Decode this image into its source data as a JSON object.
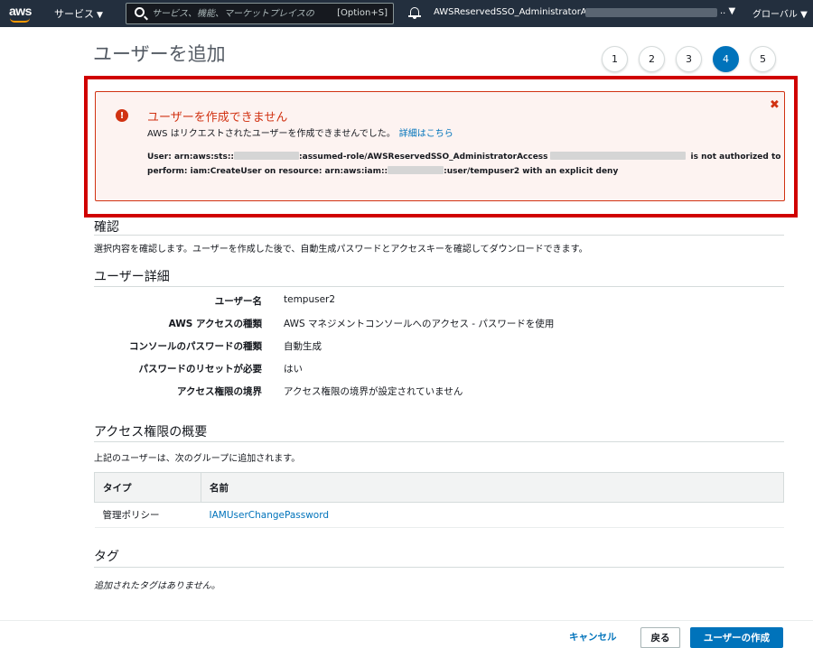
{
  "nav": {
    "logo_text": "aws",
    "services_label": "サービス",
    "services_caret": "▼",
    "search_placeholder": "サービス、機能、マーケットプレイスの",
    "search_shortcut": "[Option+S]",
    "account_label": "AWSReservedSSO_AdministratorAccess_",
    "account_tail": ".. ▼",
    "region_label": "グローバル ▼"
  },
  "page": {
    "title": "ユーザーを追加",
    "steps": [
      "1",
      "2",
      "3",
      "4",
      "5"
    ],
    "active_step": "4"
  },
  "error": {
    "icon": "!",
    "title": "ユーザーを作成できません",
    "description": "AWS はリクエストされたユーザーを作成できませんでした。",
    "link": "詳細はこちら",
    "close": "✖",
    "line1_a": "User: arn:aws:sts::",
    "line1_b": ":assumed-role/AWSReservedSSO_AdministratorAccess",
    "line1_c": "is not authorized to",
    "line2_a": "perform: iam:CreateUser on resource: arn:aws:iam::",
    "line2_b": ":user/tempuser2 with an explicit deny"
  },
  "review": {
    "heading": "確認",
    "description": "選択内容を確認します。ユーザーを作成した後で、自動生成パスワードとアクセスキーを確認してダウンロードできます。"
  },
  "user_details": {
    "heading": "ユーザー詳細",
    "rows": [
      {
        "label": "ユーザー名",
        "value": "tempuser2"
      },
      {
        "label": "AWS アクセスの種類",
        "value": "AWS マネジメントコンソールへのアクセス - パスワードを使用"
      },
      {
        "label": "コンソールのパスワードの種類",
        "value": "自動生成"
      },
      {
        "label": "パスワードのリセットが必要",
        "value": "はい"
      },
      {
        "label": "アクセス権限の境界",
        "value": "アクセス権限の境界が設定されていません"
      }
    ]
  },
  "permissions": {
    "heading": "アクセス権限の概要",
    "description": "上記のユーザーは、次のグループに追加されます。",
    "columns": [
      "タイプ",
      "名前"
    ],
    "rows": [
      {
        "type": "管理ポリシー",
        "name": "IAMUserChangePassword"
      }
    ]
  },
  "tags": {
    "heading": "タグ",
    "empty": "追加されたタグはありません。"
  },
  "footer": {
    "cancel": "キャンセル",
    "back": "戻る",
    "create": "ユーザーの作成"
  }
}
